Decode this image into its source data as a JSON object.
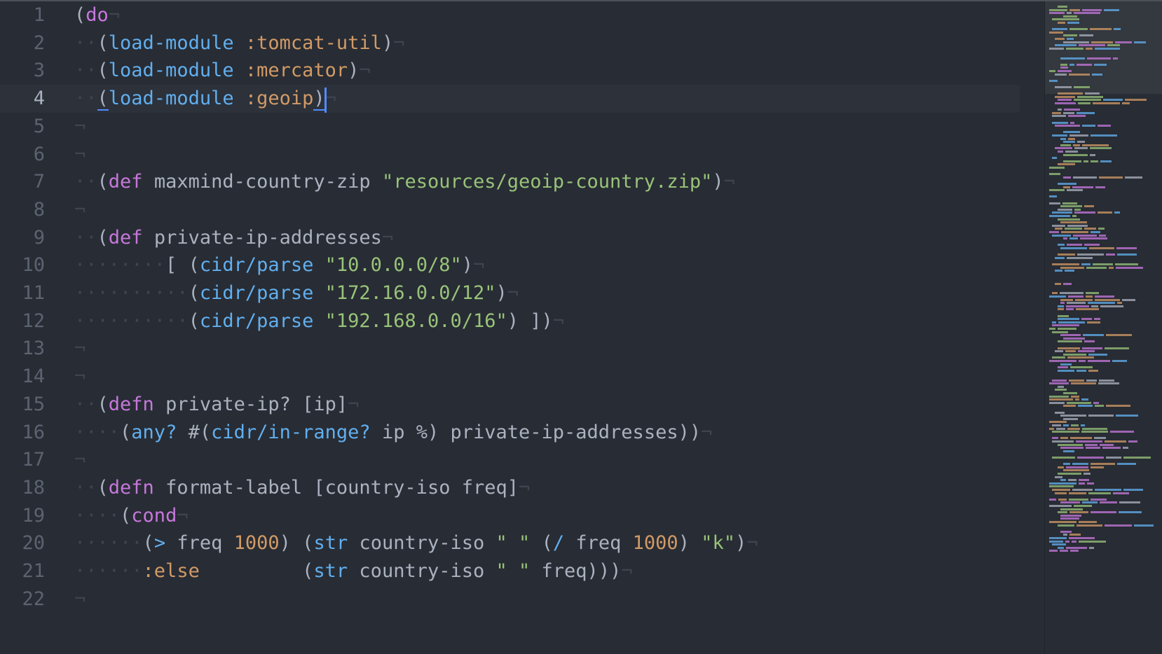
{
  "editor": {
    "current_line": 4,
    "cursor_column": 22,
    "lines": [
      {
        "n": "1",
        "indent": 0,
        "tokens": [
          {
            "t": "(",
            "c": "txt"
          },
          {
            "t": "do",
            "c": "kw"
          }
        ]
      },
      {
        "n": "2",
        "indent": 2,
        "tokens": [
          {
            "t": "(",
            "c": "txt"
          },
          {
            "t": "load-module",
            "c": "fn"
          },
          {
            "t": " ",
            "c": "txt"
          },
          {
            "t": ":tomcat-util",
            "c": "sym"
          },
          {
            "t": ")",
            "c": "txt"
          }
        ]
      },
      {
        "n": "3",
        "indent": 2,
        "tokens": [
          {
            "t": "(",
            "c": "txt"
          },
          {
            "t": "load-module",
            "c": "fn"
          },
          {
            "t": " ",
            "c": "txt"
          },
          {
            "t": ":mercator",
            "c": "sym"
          },
          {
            "t": ")",
            "c": "txt"
          }
        ]
      },
      {
        "n": "4",
        "indent": 2,
        "tokens": [
          {
            "t": "(",
            "c": "txt"
          },
          {
            "t": "load-module",
            "c": "fn"
          },
          {
            "t": " ",
            "c": "txt"
          },
          {
            "t": ":geoip",
            "c": "sym"
          },
          {
            "t": ")",
            "c": "txt"
          }
        ]
      },
      {
        "n": "5",
        "indent": 0,
        "tokens": []
      },
      {
        "n": "6",
        "indent": 0,
        "tokens": []
      },
      {
        "n": "7",
        "indent": 2,
        "tokens": [
          {
            "t": "(",
            "c": "txt"
          },
          {
            "t": "def",
            "c": "kw"
          },
          {
            "t": " maxmind-country-zip ",
            "c": "txt"
          },
          {
            "t": "\"resources/geoip-country.zip\"",
            "c": "str"
          },
          {
            "t": ")",
            "c": "txt"
          }
        ]
      },
      {
        "n": "8",
        "indent": 0,
        "tokens": []
      },
      {
        "n": "9",
        "indent": 2,
        "tokens": [
          {
            "t": "(",
            "c": "txt"
          },
          {
            "t": "def",
            "c": "kw"
          },
          {
            "t": " private-ip-addresses",
            "c": "txt"
          }
        ]
      },
      {
        "n": "10",
        "indent": 8,
        "tokens": [
          {
            "t": "[ (",
            "c": "txt"
          },
          {
            "t": "cidr/parse",
            "c": "fn"
          },
          {
            "t": " ",
            "c": "txt"
          },
          {
            "t": "\"10.0.0.0/8\"",
            "c": "str"
          },
          {
            "t": ")",
            "c": "txt"
          }
        ]
      },
      {
        "n": "11",
        "indent": 10,
        "tokens": [
          {
            "t": "(",
            "c": "txt"
          },
          {
            "t": "cidr/parse",
            "c": "fn"
          },
          {
            "t": " ",
            "c": "txt"
          },
          {
            "t": "\"172.16.0.0/12\"",
            "c": "str"
          },
          {
            "t": ")",
            "c": "txt"
          }
        ]
      },
      {
        "n": "12",
        "indent": 10,
        "tokens": [
          {
            "t": "(",
            "c": "txt"
          },
          {
            "t": "cidr/parse",
            "c": "fn"
          },
          {
            "t": " ",
            "c": "txt"
          },
          {
            "t": "\"192.168.0.0/16\"",
            "c": "str"
          },
          {
            "t": ") ])",
            "c": "txt"
          }
        ]
      },
      {
        "n": "13",
        "indent": 0,
        "tokens": []
      },
      {
        "n": "14",
        "indent": 0,
        "tokens": []
      },
      {
        "n": "15",
        "indent": 2,
        "tokens": [
          {
            "t": "(",
            "c": "txt"
          },
          {
            "t": "defn",
            "c": "kw"
          },
          {
            "t": " private-ip? [ip]",
            "c": "txt"
          }
        ]
      },
      {
        "n": "16",
        "indent": 4,
        "tokens": [
          {
            "t": "(",
            "c": "txt"
          },
          {
            "t": "any?",
            "c": "fn"
          },
          {
            "t": " #(",
            "c": "txt"
          },
          {
            "t": "cidr/in-range?",
            "c": "fn"
          },
          {
            "t": " ip %) private-ip-addresses))",
            "c": "txt"
          }
        ]
      },
      {
        "n": "17",
        "indent": 0,
        "tokens": []
      },
      {
        "n": "18",
        "indent": 2,
        "tokens": [
          {
            "t": "(",
            "c": "txt"
          },
          {
            "t": "defn",
            "c": "kw"
          },
          {
            "t": " format-label [country-iso freq]",
            "c": "txt"
          }
        ]
      },
      {
        "n": "19",
        "indent": 4,
        "tokens": [
          {
            "t": "(",
            "c": "txt"
          },
          {
            "t": "cond",
            "c": "kw"
          }
        ]
      },
      {
        "n": "20",
        "indent": 6,
        "tokens": [
          {
            "t": "(",
            "c": "txt"
          },
          {
            "t": ">",
            "c": "fn"
          },
          {
            "t": " freq ",
            "c": "txt"
          },
          {
            "t": "1000",
            "c": "num"
          },
          {
            "t": ") (",
            "c": "txt"
          },
          {
            "t": "str",
            "c": "fn"
          },
          {
            "t": " country-iso ",
            "c": "txt"
          },
          {
            "t": "\" \"",
            "c": "str"
          },
          {
            "t": " (",
            "c": "txt"
          },
          {
            "t": "/",
            "c": "fn"
          },
          {
            "t": " freq ",
            "c": "txt"
          },
          {
            "t": "1000",
            "c": "num"
          },
          {
            "t": ") ",
            "c": "txt"
          },
          {
            "t": "\"k\"",
            "c": "str"
          },
          {
            "t": ")",
            "c": "txt"
          }
        ]
      },
      {
        "n": "21",
        "indent": 6,
        "tokens": [
          {
            "t": ":else",
            "c": "sym"
          },
          {
            "t": "         (",
            "c": "txt"
          },
          {
            "t": "str",
            "c": "fn"
          },
          {
            "t": " country-iso ",
            "c": "txt"
          },
          {
            "t": "\" \"",
            "c": "str"
          },
          {
            "t": " freq)))",
            "c": "txt"
          }
        ]
      },
      {
        "n": "22",
        "indent": 0,
        "tokens": []
      }
    ],
    "whitespace_glyph": "·",
    "eol_glyph": "¬"
  },
  "colors": {
    "background": "#282c34",
    "keyword": "#c678dd",
    "function": "#61afef",
    "string": "#98c379",
    "number": "#d19a66",
    "text": "#abb2bf",
    "cursor": "#528bff"
  }
}
